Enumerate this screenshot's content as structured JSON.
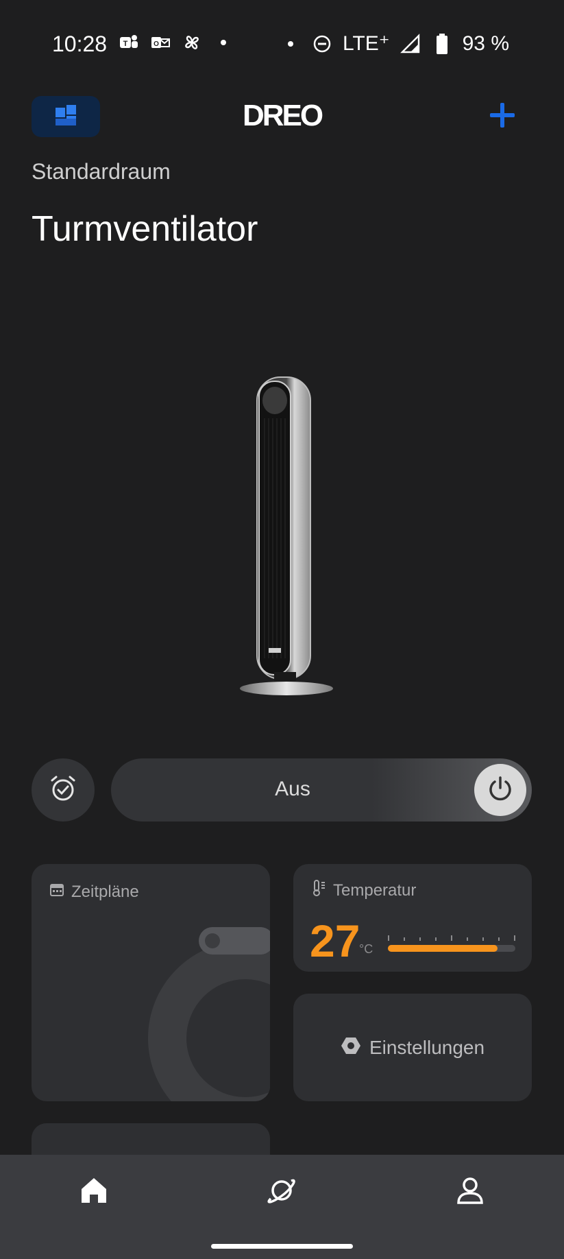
{
  "status_bar": {
    "time": "10:28",
    "network": "LTE⁺",
    "battery": "93 %",
    "icons_left": [
      "teams-icon",
      "outlook-icon",
      "fan-app-icon"
    ],
    "icons_right": [
      "dnd-icon",
      "signal-icon",
      "battery-icon"
    ]
  },
  "header": {
    "logo": "DREO",
    "menu_icon": "dashboard-icon",
    "add_icon": "plus-icon",
    "accent_color": "#1a6ae6"
  },
  "device": {
    "room": "Standardraum",
    "name": "Turmventilator"
  },
  "controls": {
    "power_label": "Aus",
    "timer_icon": "alarm-check-icon",
    "power_icon": "power-icon"
  },
  "cards": {
    "schedules": {
      "title": "Zeitpläne",
      "icon": "calendar-icon"
    },
    "temperature": {
      "title": "Temperatur",
      "icon": "thermometer-icon",
      "value": "27",
      "unit": "°C",
      "level_fraction": 0.86,
      "color": "#f7941d"
    },
    "settings": {
      "title": "Einstellungen",
      "icon": "hexagon-settings-icon"
    }
  },
  "bottom_nav": {
    "items": [
      {
        "icon": "home-icon",
        "active": true
      },
      {
        "icon": "planet-icon",
        "active": false
      },
      {
        "icon": "profile-icon",
        "active": false
      }
    ]
  }
}
